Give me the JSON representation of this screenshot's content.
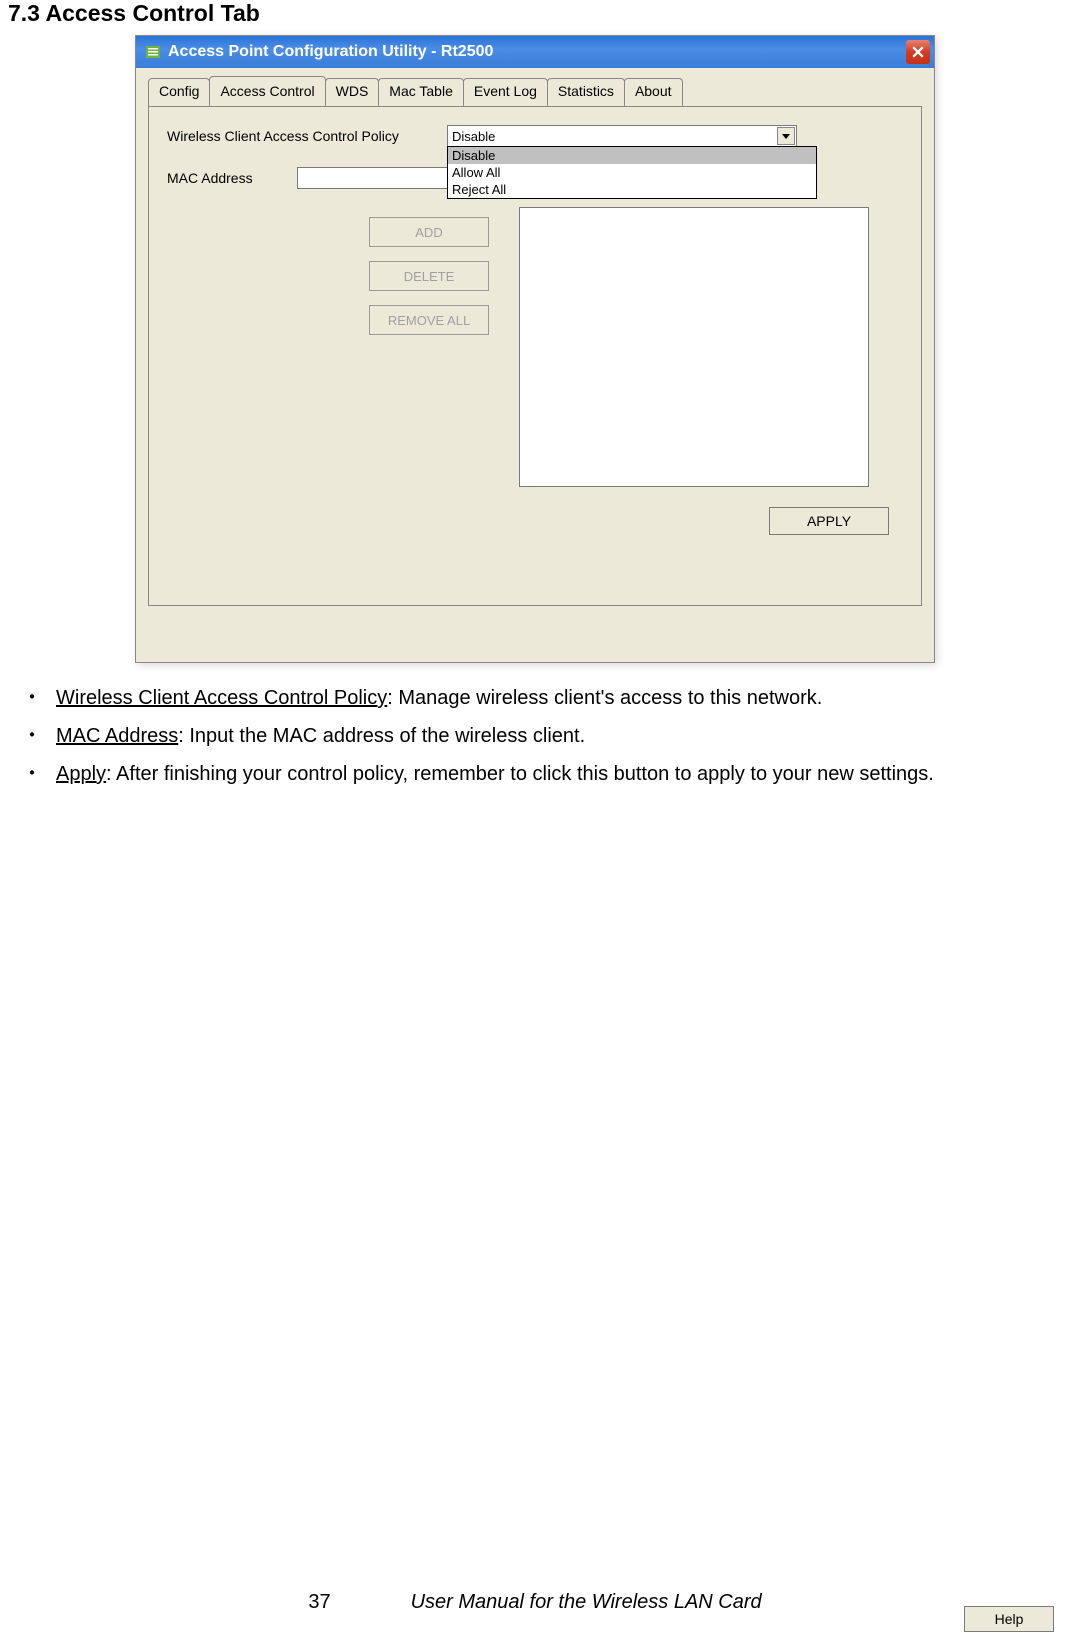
{
  "section_title": "7.3 Access Control Tab",
  "window": {
    "title": "Access Point Configuration Utility - Rt2500",
    "tabs": [
      "Config",
      "Access Control",
      "WDS",
      "Mac Table",
      "Event Log",
      "Statistics",
      "About"
    ],
    "active_tab": "Access Control",
    "policy_label": "Wireless Client Access Control Policy",
    "policy_value": "Disable",
    "policy_options": [
      "Disable",
      "Allow All",
      "Reject All"
    ],
    "mac_label": "MAC Address",
    "buttons": {
      "add": "ADD",
      "delete": "DELETE",
      "removeall": "REMOVE ALL"
    },
    "apply": "APPLY",
    "help": "Help"
  },
  "bullets": [
    {
      "term": "Wireless Client Access Control Policy",
      "desc": ": Manage wireless client's access to this network."
    },
    {
      "term": "MAC Address",
      "desc": ": Input the MAC address of the wireless client."
    },
    {
      "term": "Apply",
      "desc": ": After finishing your control policy, remember to click this button to apply to your new settings."
    }
  ],
  "footer": {
    "page": "37",
    "doc": "User Manual for the Wireless LAN Card"
  }
}
